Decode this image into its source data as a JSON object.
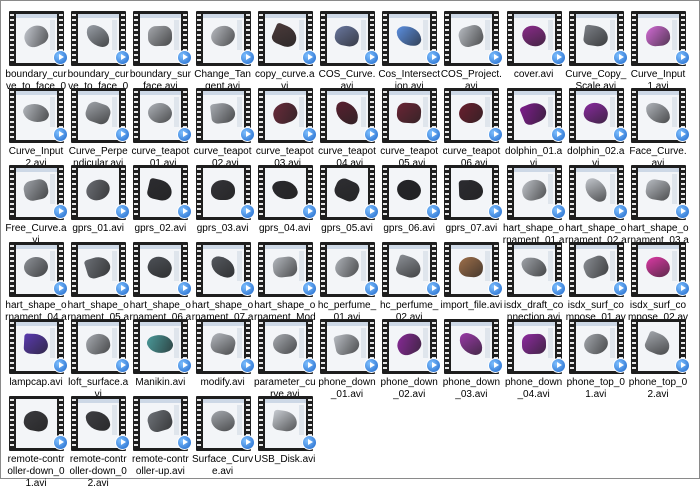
{
  "files": [
    {
      "name": "boundary_curve_to_face_02.avi",
      "icon": "video-file-icon",
      "color": "#c8ccd4"
    },
    {
      "name": "boundary_curve_to_face_03.avi",
      "icon": "video-file-icon",
      "color": "#9aa0a8"
    },
    {
      "name": "boundary_surface.avi",
      "icon": "video-file-icon",
      "color": "#a5a8ad"
    },
    {
      "name": "Change_Tangent.avi",
      "icon": "video-file-icon",
      "color": "#b9bcc2"
    },
    {
      "name": "copy_curve.avi",
      "icon": "video-file-icon",
      "color": "#4a3a3a"
    },
    {
      "name": "COS_Curve.avi",
      "icon": "video-file-icon",
      "color": "#6a78a0"
    },
    {
      "name": "Cos_Intersection.avi",
      "icon": "video-file-icon",
      "color": "#5b8fe0"
    },
    {
      "name": "COS_Project.avi",
      "icon": "video-file-icon",
      "color": "#b8bcc2"
    },
    {
      "name": "cover.avi",
      "icon": "video-file-icon",
      "color": "#8e2b8e"
    },
    {
      "name": "Curve_Copy_Scale.avi",
      "icon": "video-file-icon",
      "color": "#7b7f86"
    },
    {
      "name": "Curve_Input1.avi",
      "icon": "video-file-icon",
      "color": "#d36bd6"
    },
    {
      "name": "Curve_Input2.avi",
      "icon": "video-file-icon",
      "color": "#b4b8be"
    },
    {
      "name": "Curve_Perpendicular.avi",
      "icon": "video-file-icon",
      "color": "#a0a4aa"
    },
    {
      "name": "curve_teapot_01.avi",
      "icon": "video-file-icon",
      "color": "#b0b4ba"
    },
    {
      "name": "curve_teapot_02.avi",
      "icon": "video-file-icon",
      "color": "#a8acb2"
    },
    {
      "name": "curve_teapot_03.avi",
      "icon": "video-file-icon",
      "color": "#6a2a3a"
    },
    {
      "name": "curve_teapot_04.avi",
      "icon": "video-file-icon",
      "color": "#5a2030"
    },
    {
      "name": "curve_teapot_05.avi",
      "icon": "video-file-icon",
      "color": "#6b2535"
    },
    {
      "name": "curve_teapot_06.avi",
      "icon": "video-file-icon",
      "color": "#6a1e2e"
    },
    {
      "name": "dolphin_01.avi",
      "icon": "video-file-icon",
      "color": "#7d1c8c"
    },
    {
      "name": "dolphin_02.avi",
      "icon": "video-file-icon",
      "color": "#8a2aa0"
    },
    {
      "name": "Face_Curve.avi",
      "icon": "video-file-icon",
      "color": "#b0b4ba"
    },
    {
      "name": "Free_Curve.avi",
      "icon": "video-file-icon",
      "color": "#9ea2a8"
    },
    {
      "name": "gprs_01.avi",
      "icon": "video-file-icon",
      "color": "#6c6f75"
    },
    {
      "name": "gprs_02.avi",
      "icon": "video-file-icon",
      "color": "#2c2c30"
    },
    {
      "name": "gprs_03.avi",
      "icon": "video-file-icon",
      "color": "#333338"
    },
    {
      "name": "gprs_04.avi",
      "icon": "video-file-icon",
      "color": "#2a2a2e"
    },
    {
      "name": "gprs_05.avi",
      "icon": "video-file-icon",
      "color": "#2e2e32"
    },
    {
      "name": "gprs_06.avi",
      "icon": "video-file-icon",
      "color": "#242428"
    },
    {
      "name": "gprs_07.avi",
      "icon": "video-file-icon",
      "color": "#2b2b30"
    },
    {
      "name": "hart_shape_ornament_01.avi",
      "icon": "video-file-icon",
      "color": "#c0c4ca"
    },
    {
      "name": "hart_shape_ornament_02.avi",
      "icon": "video-file-icon",
      "color": "#c4c8ce"
    },
    {
      "name": "hart_shape_ornament_03.avi",
      "icon": "video-file-icon",
      "color": "#b8bcc2"
    },
    {
      "name": "hart_shape_ornament_04.avi",
      "icon": "video-file-icon",
      "color": "#8e9298"
    },
    {
      "name": "hart_shape_ornament_05.avi",
      "icon": "video-file-icon",
      "color": "#6a6e74"
    },
    {
      "name": "hart_shape_ornament_06.avi",
      "icon": "video-file-icon",
      "color": "#4e5258"
    },
    {
      "name": "hart_shape_ornament_07.avi",
      "icon": "video-file-icon",
      "color": "#55595f"
    },
    {
      "name": "hart_shape_ornament_Modify.avi",
      "icon": "video-file-icon",
      "color": "#b4b8be"
    },
    {
      "name": "hc_perfume_01.avi",
      "icon": "video-file-icon",
      "color": "#b0b4ba"
    },
    {
      "name": "hc_perfume_02.avi",
      "icon": "video-file-icon",
      "color": "#8a8e94"
    },
    {
      "name": "import_file.avi",
      "icon": "video-file-icon",
      "color": "#a0704a"
    },
    {
      "name": "isdx_draft_connection.avi",
      "icon": "video-file-icon",
      "color": "#9ea2a8"
    },
    {
      "name": "isdx_surf_compose_01.avi",
      "icon": "video-file-icon",
      "color": "#8a8e94"
    },
    {
      "name": "isdx_surf_compose_02.avi",
      "icon": "video-file-icon",
      "color": "#e03aa8"
    },
    {
      "name": "lampcap.avi",
      "icon": "video-file-icon",
      "color": "#5a3ab0"
    },
    {
      "name": "loft_surface.avi",
      "icon": "video-file-icon",
      "color": "#a8acb2"
    },
    {
      "name": "Manikin.avi",
      "icon": "video-file-icon",
      "color": "#4a9a9a"
    },
    {
      "name": "modify.avi",
      "icon": "video-file-icon",
      "color": "#b4b8be"
    },
    {
      "name": "parameter_curve.avi",
      "icon": "video-file-icon",
      "color": "#a8acb2"
    },
    {
      "name": "phone_down_01.avi",
      "icon": "video-file-icon",
      "color": "#b8bcc2"
    },
    {
      "name": "phone_down_02.avi",
      "icon": "video-file-icon",
      "color": "#8a2a9a"
    },
    {
      "name": "phone_down_03.avi",
      "icon": "video-file-icon",
      "color": "#9a3aa8"
    },
    {
      "name": "phone_down_04.avi",
      "icon": "video-file-icon",
      "color": "#8e2aa0"
    },
    {
      "name": "phone_top_01.avi",
      "icon": "video-file-icon",
      "color": "#a4a8ae"
    },
    {
      "name": "phone_top_02.avi",
      "icon": "video-file-icon",
      "color": "#a0a4aa"
    },
    {
      "name": "remote-controller-down_01.avi",
      "icon": "video-file-icon",
      "color": "#3a3a3e"
    },
    {
      "name": "remote-controller-down_02.avi",
      "icon": "video-file-icon",
      "color": "#3e3e42"
    },
    {
      "name": "remote-controller-up.avi",
      "icon": "video-file-icon",
      "color": "#6e7278"
    },
    {
      "name": "Surface_Curve.avi",
      "icon": "video-file-icon",
      "color": "#a8acb2"
    },
    {
      "name": "USB_Disk.avi",
      "icon": "video-file-icon",
      "color": "#c8ccd2"
    }
  ]
}
